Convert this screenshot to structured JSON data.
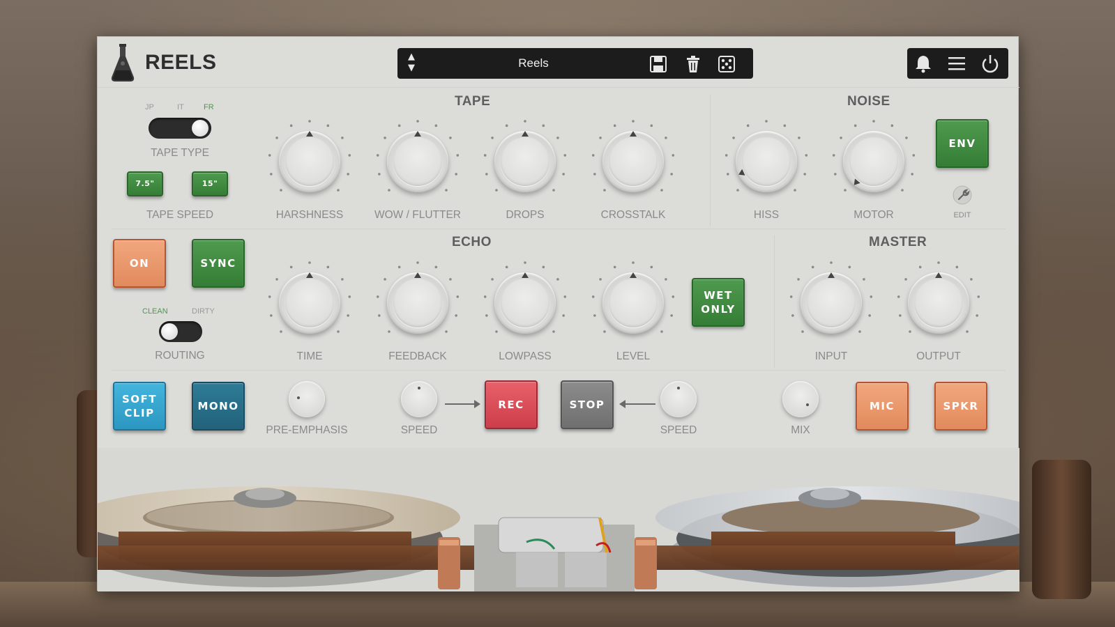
{
  "app": {
    "title": "REELS"
  },
  "preset": {
    "name": "Reels"
  },
  "header": {
    "save_icon": "save-icon",
    "delete_icon": "trash-icon",
    "random_icon": "dice-icon",
    "notify_icon": "bell-icon",
    "menu_icon": "menu-icon",
    "power_icon": "power-icon"
  },
  "tape": {
    "title": "TAPE",
    "type_options": [
      "JP",
      "IT",
      "FR"
    ],
    "type_label": "TAPE TYPE",
    "speed_buttons": [
      "7.5\"",
      "15\""
    ],
    "speed_label": "TAPE SPEED",
    "knobs": [
      "HARSHNESS",
      "WOW / FLUTTER",
      "DROPS",
      "CROSSTALK"
    ]
  },
  "noise": {
    "title": "NOISE",
    "knobs": [
      "HISS",
      "MOTOR"
    ],
    "env_button": "ENV",
    "edit_label": "EDIT"
  },
  "echo": {
    "title": "ECHO",
    "on_button": "ON",
    "sync_button": "SYNC",
    "routing_options": [
      "CLEAN",
      "DIRTY"
    ],
    "routing_label": "ROUTING",
    "knobs": [
      "TIME",
      "FEEDBACK",
      "LOWPASS",
      "LEVEL"
    ],
    "wet_only_button": "WET ONLY"
  },
  "master": {
    "title": "MASTER",
    "knobs": [
      "INPUT",
      "OUTPUT"
    ]
  },
  "bottom": {
    "soft_clip_button": "SOFT CLIP",
    "mono_button": "MONO",
    "pre_emphasis_label": "PRE-EMPHASIS",
    "speed_label_left": "SPEED",
    "rec_button": "REC",
    "stop_button": "STOP",
    "speed_label_right": "SPEED",
    "mix_label": "MIX",
    "mic_button": "MIC",
    "spkr_button": "SPKR"
  },
  "colors": {
    "green": "#3f8a40",
    "orange": "#eb9a6d",
    "blue": "#37a8d2",
    "teal": "#286f89",
    "red": "#d94e59",
    "gray": "#7d7d7d",
    "panel": "#dcdcd9"
  }
}
